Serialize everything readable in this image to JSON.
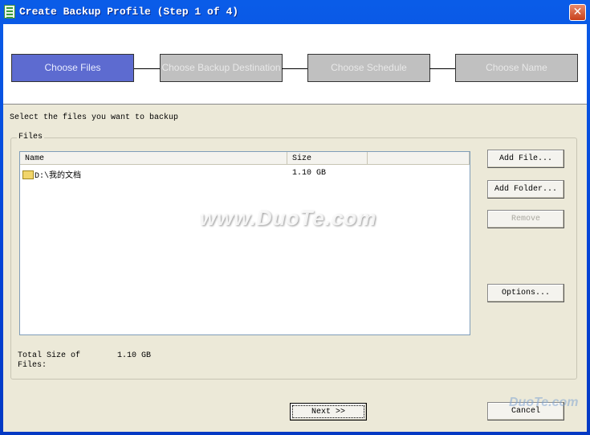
{
  "window": {
    "title": "Create Backup Profile (Step 1 of 4)",
    "close_icon": "close-icon"
  },
  "steps": [
    {
      "label": "Choose Files",
      "active": true
    },
    {
      "label": "Choose Backup Destination",
      "active": false
    },
    {
      "label": "Choose Schedule",
      "active": false
    },
    {
      "label": "Choose Name",
      "active": false
    }
  ],
  "colors": {
    "active_step": "#5d6bd0",
    "inactive_step": "#c0c0c0",
    "titlebar": "#0343d6"
  },
  "instruction": "Select the files you want to backup",
  "files_group": {
    "title": "Files",
    "columns": [
      "Name",
      "Size"
    ],
    "rows": [
      {
        "name": "D:\\我的文档",
        "size": "1.10 GB",
        "icon": "folder-icon"
      }
    ],
    "total_label": "Total Size of Files:",
    "total_value": "1.10 GB"
  },
  "buttons": {
    "add_file": "Add File...",
    "add_folder": "Add Folder...",
    "remove": "Remove",
    "options": "Options...",
    "next": "Next >>",
    "cancel": "Cancel"
  },
  "watermark": "www.DuoTe.com",
  "watermark2": "DuoTe.com"
}
